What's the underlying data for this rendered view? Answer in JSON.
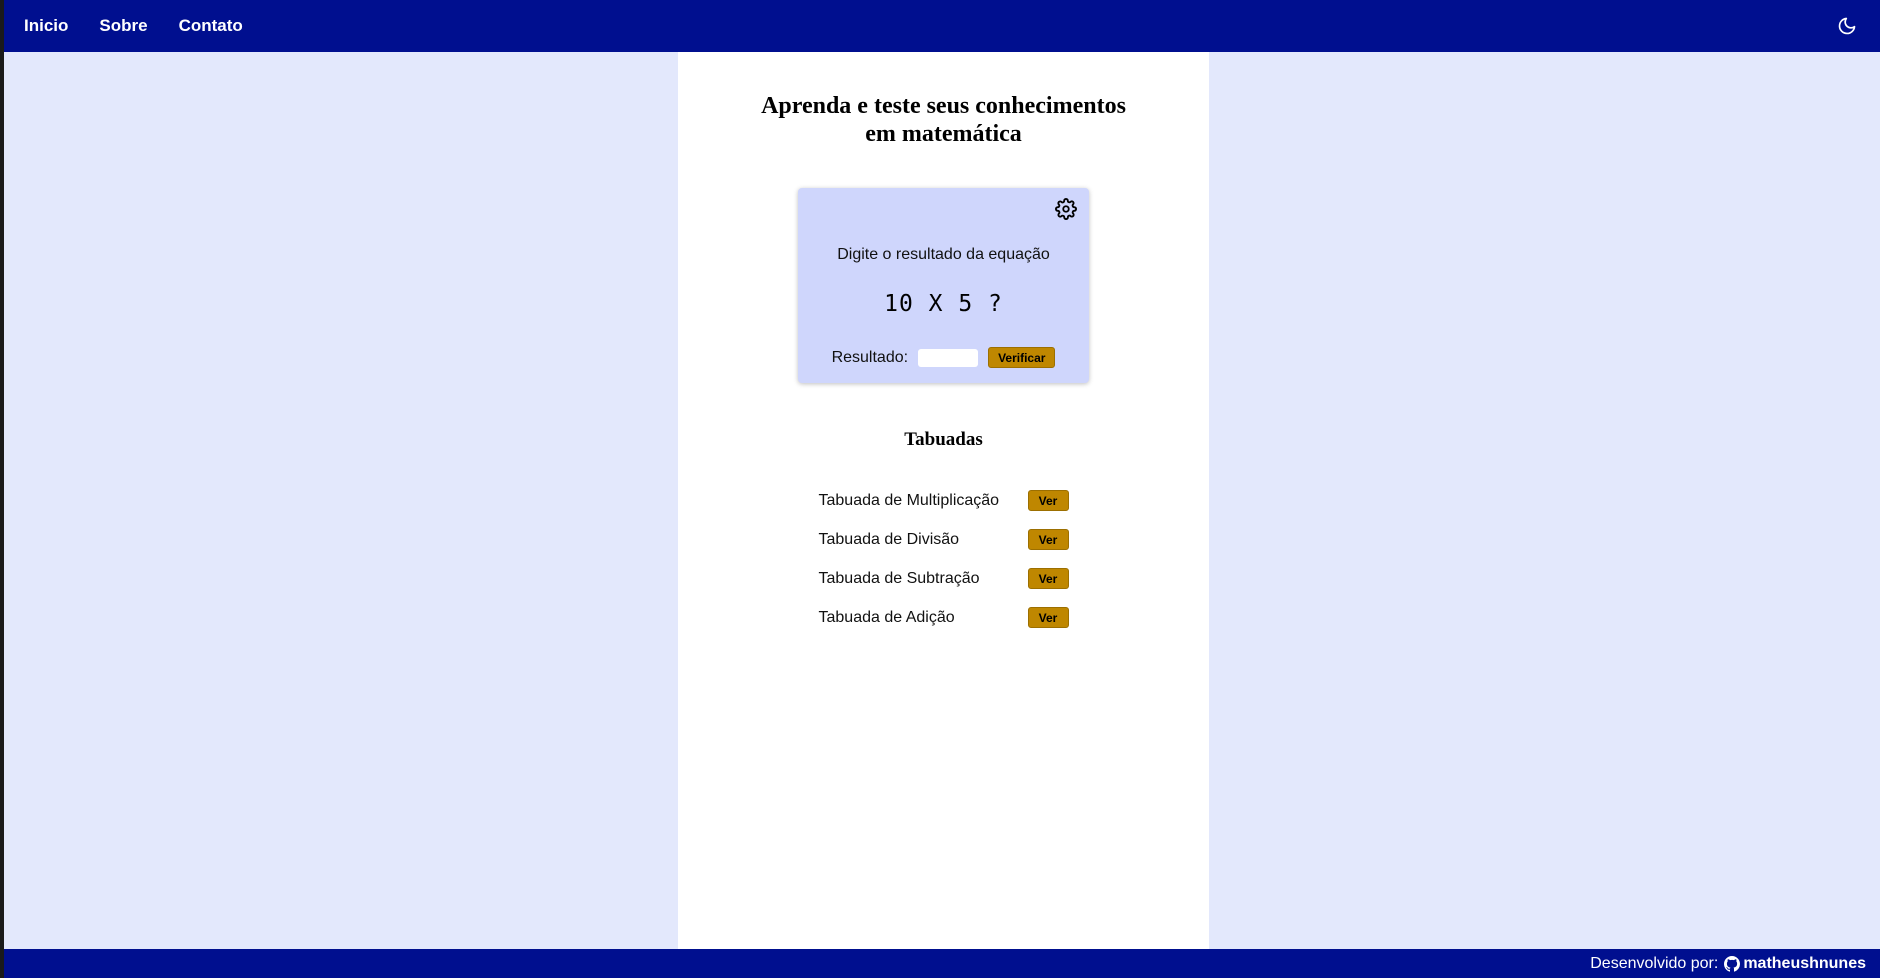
{
  "nav": {
    "links": [
      "Inicio",
      "Sobre",
      "Contato"
    ],
    "theme_toggle_icon": "moon-icon"
  },
  "page_title": "Aprenda e teste seus conhecimentos em matemática",
  "quiz": {
    "settings_icon": "gear-icon",
    "instruction": "Digite o resultado da equação",
    "equation": "10 X 5 ?",
    "result_label": "Resultado:",
    "result_value": "",
    "verify_label": "Verificar"
  },
  "tables": {
    "title": "Tabuadas",
    "items": [
      {
        "label": "Tabuada de Multiplicação",
        "button": "Ver"
      },
      {
        "label": "Tabuada de Divisão",
        "button": "Ver"
      },
      {
        "label": "Tabuada de Subtração",
        "button": "Ver"
      },
      {
        "label": "Tabuada de Adição",
        "button": "Ver"
      }
    ]
  },
  "footer": {
    "credit_prefix": "Desenvolvido por:",
    "author": "matheushnunes",
    "author_icon": "github-icon"
  },
  "colors": {
    "navbar": "#000f8f",
    "page_bg": "#e3e8fc",
    "card_bg": "#cfd6fc",
    "button": "#bf8700"
  }
}
